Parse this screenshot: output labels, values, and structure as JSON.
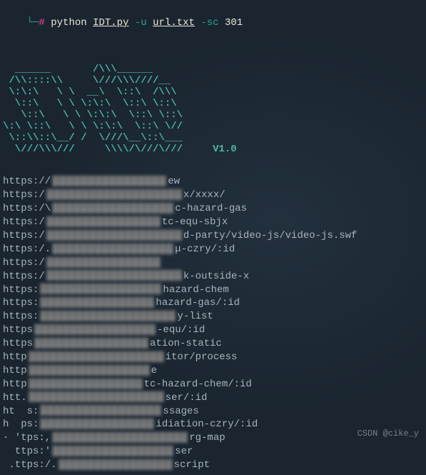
{
  "prompt": {
    "branch": "└─",
    "hash": "#",
    "cmd_python": "python",
    "cmd_script": "IDT.py",
    "flag_u": "-u",
    "arg_url": "url.txt",
    "flag_sc": "-sc",
    "arg_code": "301"
  },
  "ascii_art": "  ______       /\\\\\\______\n /\\\\::::\\\\     \\///\\\\\\////__\n \\:\\:\\   \\ \\  __\\  \\::\\  /\\\\\\\n  \\::\\   \\ \\ \\:\\:\\  \\::\\ \\::\\\n   \\::\\   \\ \\ \\:\\:\\  \\::\\ \\::\\\n\\:\\ \\::\\   \\ \\ \\:\\:\\  \\::\\ \\//\n \\::\\\\::\\__/ /  \\///\\__\\::\\___\n  \\///\\\\\\///     \\\\\\\\/\\///\\///",
  "ascii_lines": [
    "  ______       /\\\\\\______",
    " /\\\\::::\\\\     \\///\\\\\\////__",
    " \\:\\:\\   \\ \\  __\\  \\::\\  /\\\\\\",
    "  \\::\\   \\ \\ \\:\\:\\  \\::\\ \\::\\",
    "   \\::\\   \\ \\ \\:\\:\\  \\::\\ \\::\\",
    "\\:\\ \\::\\   \\ \\ \\:\\:\\  \\::\\ \\//",
    " \\::\\\\::\\__/ /  \\///\\__\\::\\___",
    "  \\///\\\\\\///     \\\\\\\\/\\///\\///     "
  ],
  "version": "V1.0",
  "output_lines": [
    {
      "pre": "https://",
      "post": "ew"
    },
    {
      "pre": "https:/",
      "post": "x/xxxx/"
    },
    {
      "pre": "https:/\\",
      "post": "c-hazard-gas"
    },
    {
      "pre": "https:/",
      "post": "tc-equ-sbjx"
    },
    {
      "pre": "https:/",
      "post": "d-party/video-js/video-js.swf"
    },
    {
      "pre": "https:/.",
      "post": "μ-czry/:id"
    },
    {
      "pre": "https:/",
      "post": ""
    },
    {
      "pre": "https:/",
      "post": "k-outside-x"
    },
    {
      "pre": "https:",
      "post": "hazard-chem"
    },
    {
      "pre": "https:",
      "post": "hazard-gas/:id"
    },
    {
      "pre": "https:",
      "post": "y-list"
    },
    {
      "pre": "https",
      "post": "-equ/:id"
    },
    {
      "pre": "https",
      "post": "ation-static"
    },
    {
      "pre": "http",
      "post": "itor/process"
    },
    {
      "pre": "http",
      "post": "e"
    },
    {
      "pre": "http",
      "post": "tc-hazard-chem/:id"
    },
    {
      "pre": "htt.",
      "post": "ser/:id"
    },
    {
      "pre": "ht  s:",
      "post": "ssages"
    },
    {
      "pre": "h  ps:",
      "post": "idiation-czry/:id"
    },
    {
      "pre": "· 'tps:,",
      "post": "rg-map"
    },
    {
      "pre": "  ttps:'",
      "post": "ser"
    },
    {
      "pre": " .ttps:/.",
      "post": "script"
    }
  ],
  "watermark": "CSDN @cike_y"
}
